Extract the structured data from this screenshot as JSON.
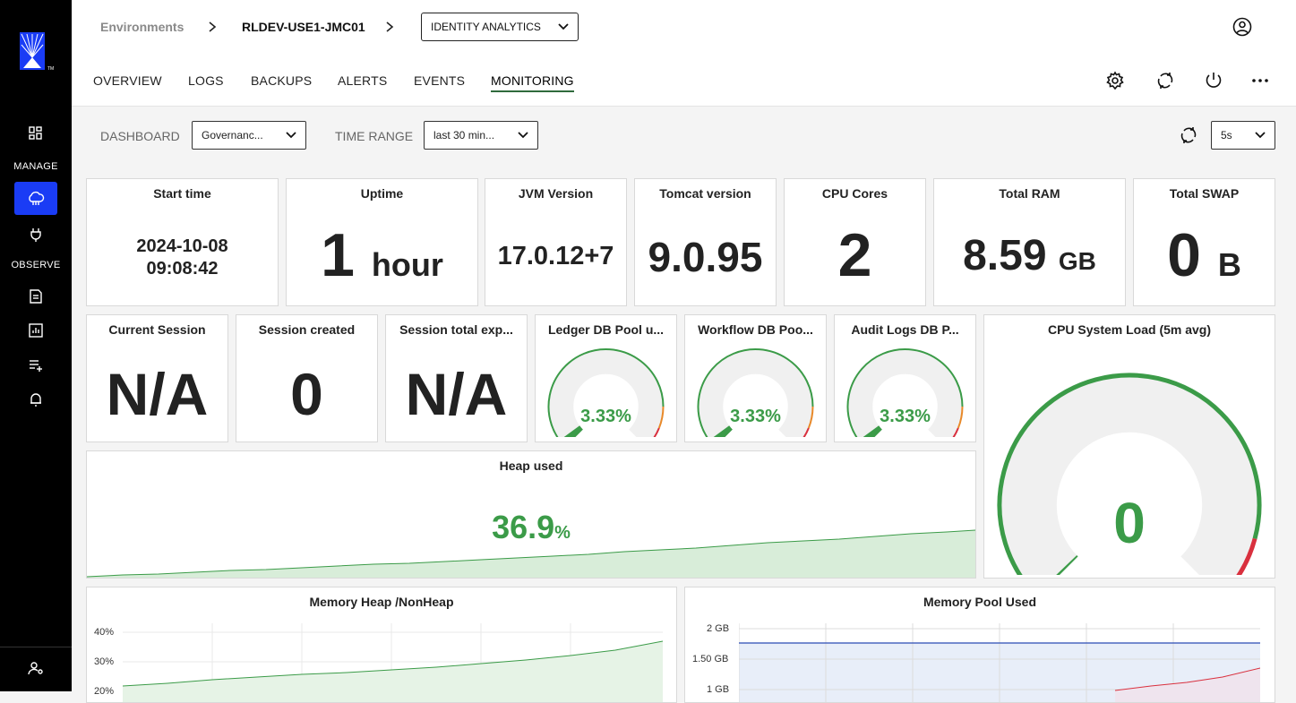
{
  "breadcrumb": {
    "environments": "Environments",
    "env_name": "RLDEV-USE1-JMC01",
    "app": "IDENTITY ANALYTICS"
  },
  "sidebar": {
    "manage_label": "MANAGE",
    "observe_label": "OBSERVE"
  },
  "tabs": [
    "OVERVIEW",
    "LOGS",
    "BACKUPS",
    "ALERTS",
    "EVENTS",
    "MONITORING"
  ],
  "active_tab": "MONITORING",
  "filters": {
    "dashboard_label": "DASHBOARD",
    "dashboard_value": "Governanc...",
    "time_range_label": "TIME RANGE",
    "time_range_value": "last 30 min...",
    "refresh_value": "5s"
  },
  "stats": {
    "start_time": {
      "title": "Start time",
      "date": "2024-10-08",
      "time": "09:08:42"
    },
    "uptime": {
      "title": "Uptime",
      "value": "1",
      "unit": "hour"
    },
    "jvm": {
      "title": "JVM Version",
      "value": "17.0.12+7"
    },
    "tomcat": {
      "title": "Tomcat version",
      "value": "9.0.95"
    },
    "cpu_cores": {
      "title": "CPU Cores",
      "value": "2"
    },
    "total_ram": {
      "title": "Total RAM",
      "value": "8.59",
      "unit": "GB"
    },
    "total_swap": {
      "title": "Total SWAP",
      "value": "0",
      "unit": "B"
    },
    "current_session": {
      "title": "Current Session",
      "value": "N/A"
    },
    "session_created": {
      "title": "Session created",
      "value": "0"
    },
    "session_total": {
      "title": "Session total exp...",
      "value": "N/A"
    }
  },
  "gauges": [
    {
      "title": "Ledger DB Pool u...",
      "value": "3.33%",
      "level": 0.0333
    },
    {
      "title": "Workflow DB Poo...",
      "value": "3.33%",
      "level": 0.0333
    },
    {
      "title": "Audit Logs DB P...",
      "value": "3.33%",
      "level": 0.0333
    }
  ],
  "cpu_load": {
    "title": "CPU System Load (5m avg)",
    "value": "0",
    "level": 0
  },
  "heap_used": {
    "title": "Heap used",
    "value": "36.9",
    "unit": "%"
  },
  "memory_heap": {
    "title": "Memory Heap /NonHeap",
    "yticks": [
      "40%",
      "30%",
      "20%"
    ]
  },
  "memory_pool": {
    "title": "Memory Pool Used",
    "yticks": [
      "2 GB",
      "1.50 GB",
      "1 GB"
    ]
  },
  "colors": {
    "accent": "#1a3cf5",
    "green": "#3b9b48",
    "red": "#d9303e",
    "orange": "#e8892a",
    "pool_blue": "#2a4bb5"
  }
}
